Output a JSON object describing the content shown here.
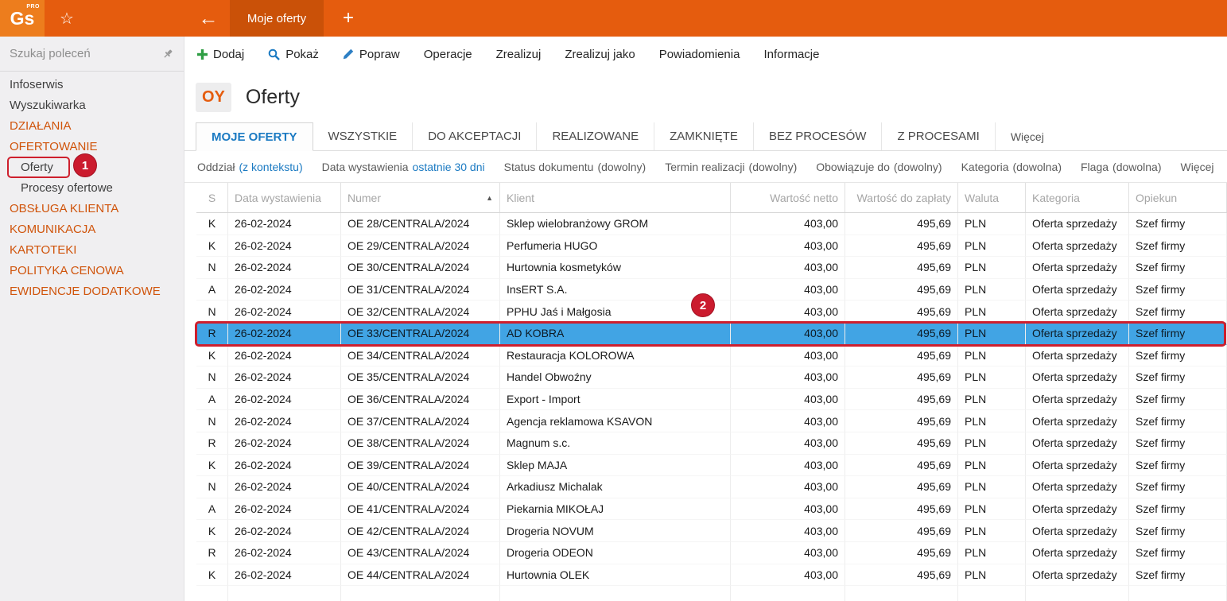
{
  "topbar": {
    "logo": "Gs",
    "logo_sup": "PRO",
    "star_icon": "☆",
    "back_arrow": "←",
    "document_tab": "Moje oferty",
    "new_tab_plus": "+"
  },
  "sidebar": {
    "search_placeholder": "Szukaj poleceń",
    "items": [
      {
        "label": "Infoserwis",
        "type": "item"
      },
      {
        "label": "Wyszukiwarka",
        "type": "item"
      },
      {
        "label": "DZIAŁANIA",
        "type": "category"
      },
      {
        "label": "OFERTOWANIE",
        "type": "category"
      },
      {
        "label": "Oferty",
        "type": "subitem",
        "annotated": true
      },
      {
        "label": "Procesy ofertowe",
        "type": "subitem"
      },
      {
        "label": "OBSŁUGA KLIENTA",
        "type": "category"
      },
      {
        "label": "KOMUNIKACJA",
        "type": "category"
      },
      {
        "label": "KARTOTEKI",
        "type": "category"
      },
      {
        "label": "POLITYKA CENOWA",
        "type": "category"
      },
      {
        "label": "EWIDENCJE DODATKOWE",
        "type": "category"
      }
    ]
  },
  "toolbar": [
    {
      "label": "Dodaj",
      "icon": "plus"
    },
    {
      "label": "Pokaż",
      "icon": "magnifier"
    },
    {
      "label": "Popraw",
      "icon": "pencil"
    },
    {
      "label": "Operacje",
      "icon": ""
    },
    {
      "label": "Zrealizuj",
      "icon": ""
    },
    {
      "label": "Zrealizuj jako",
      "icon": ""
    },
    {
      "label": "Powiadomienia",
      "icon": ""
    },
    {
      "label": "Informacje",
      "icon": ""
    }
  ],
  "page": {
    "badge": "OY",
    "title": "Oferty"
  },
  "tabs": [
    {
      "label": "MOJE OFERTY",
      "active": true,
      "more": false
    },
    {
      "label": "WSZYSTKIE",
      "active": false,
      "more": false
    },
    {
      "label": "DO AKCEPTACJI",
      "active": false,
      "more": false
    },
    {
      "label": "REALIZOWANE",
      "active": false,
      "more": false
    },
    {
      "label": "ZAMKNIĘTE",
      "active": false,
      "more": false
    },
    {
      "label": "BEZ PROCESÓW",
      "active": false,
      "more": false
    },
    {
      "label": "Z PROCESAMI",
      "active": false,
      "more": false
    },
    {
      "label": "Więcej",
      "active": false,
      "more": true
    }
  ],
  "filters": [
    {
      "label": "Oddział",
      "value": "(z kontekstu)",
      "link": true
    },
    {
      "label": "Data wystawienia",
      "value": "ostatnie 30 dni",
      "link": true
    },
    {
      "label": "Status dokumentu",
      "value": "(dowolny)",
      "link": false
    },
    {
      "label": "Termin realizacji",
      "value": "(dowolny)",
      "link": false
    },
    {
      "label": "Obowiązuje do",
      "value": "(dowolny)",
      "link": false
    },
    {
      "label": "Kategoria",
      "value": "(dowolna)",
      "link": false
    },
    {
      "label": "Flaga",
      "value": "(dowolna)",
      "link": false
    },
    {
      "label": "Więcej",
      "value": "",
      "link": false
    }
  ],
  "table": {
    "sort_indicator": "▲",
    "columns": [
      {
        "label": "S",
        "sorted": false
      },
      {
        "label": "Data wystawienia",
        "sorted": false
      },
      {
        "label": "Numer",
        "sorted": true
      },
      {
        "label": "Klient",
        "sorted": false
      },
      {
        "label": "Wartość netto",
        "sorted": false
      },
      {
        "label": "Wartość do zapłaty",
        "sorted": false
      },
      {
        "label": "Waluta",
        "sorted": false
      },
      {
        "label": "Kategoria",
        "sorted": false
      },
      {
        "label": "Opiekun",
        "sorted": false
      }
    ],
    "selected_row_index": 5,
    "rows": [
      {
        "s": "K",
        "date": "26-02-2024",
        "number": "OE 28/CENTRALA/2024",
        "client": "Sklep wielobranżowy GROM",
        "net": "403,00",
        "due": "495,69",
        "currency": "PLN",
        "category": "Oferta sprzedaży",
        "owner": "Szef firmy"
      },
      {
        "s": "K",
        "date": "26-02-2024",
        "number": "OE 29/CENTRALA/2024",
        "client": "Perfumeria HUGO",
        "net": "403,00",
        "due": "495,69",
        "currency": "PLN",
        "category": "Oferta sprzedaży",
        "owner": "Szef firmy"
      },
      {
        "s": "N",
        "date": "26-02-2024",
        "number": "OE 30/CENTRALA/2024",
        "client": "Hurtownia kosmetyków",
        "net": "403,00",
        "due": "495,69",
        "currency": "PLN",
        "category": "Oferta sprzedaży",
        "owner": "Szef firmy"
      },
      {
        "s": "A",
        "date": "26-02-2024",
        "number": "OE 31/CENTRALA/2024",
        "client": "InsERT S.A.",
        "net": "403,00",
        "due": "495,69",
        "currency": "PLN",
        "category": "Oferta sprzedaży",
        "owner": "Szef firmy"
      },
      {
        "s": "N",
        "date": "26-02-2024",
        "number": "OE 32/CENTRALA/2024",
        "client": "PPHU Jaś i Małgosia",
        "net": "403,00",
        "due": "495,69",
        "currency": "PLN",
        "category": "Oferta sprzedaży",
        "owner": "Szef firmy"
      },
      {
        "s": "R",
        "date": "26-02-2024",
        "number": "OE 33/CENTRALA/2024",
        "client": "AD KOBRA",
        "net": "403,00",
        "due": "495,69",
        "currency": "PLN",
        "category": "Oferta sprzedaży",
        "owner": "Szef firmy"
      },
      {
        "s": "K",
        "date": "26-02-2024",
        "number": "OE 34/CENTRALA/2024",
        "client": "Restauracja KOLOROWA",
        "net": "403,00",
        "due": "495,69",
        "currency": "PLN",
        "category": "Oferta sprzedaży",
        "owner": "Szef firmy"
      },
      {
        "s": "N",
        "date": "26-02-2024",
        "number": "OE 35/CENTRALA/2024",
        "client": "Handel Obwoźny",
        "net": "403,00",
        "due": "495,69",
        "currency": "PLN",
        "category": "Oferta sprzedaży",
        "owner": "Szef firmy"
      },
      {
        "s": "A",
        "date": "26-02-2024",
        "number": "OE 36/CENTRALA/2024",
        "client": "Export - Import",
        "net": "403,00",
        "due": "495,69",
        "currency": "PLN",
        "category": "Oferta sprzedaży",
        "owner": "Szef firmy"
      },
      {
        "s": "N",
        "date": "26-02-2024",
        "number": "OE 37/CENTRALA/2024",
        "client": "Agencja reklamowa KSAVON",
        "net": "403,00",
        "due": "495,69",
        "currency": "PLN",
        "category": "Oferta sprzedaży",
        "owner": "Szef firmy"
      },
      {
        "s": "R",
        "date": "26-02-2024",
        "number": "OE 38/CENTRALA/2024",
        "client": "Magnum s.c.",
        "net": "403,00",
        "due": "495,69",
        "currency": "PLN",
        "category": "Oferta sprzedaży",
        "owner": "Szef firmy"
      },
      {
        "s": "K",
        "date": "26-02-2024",
        "number": "OE 39/CENTRALA/2024",
        "client": "Sklep MAJA",
        "net": "403,00",
        "due": "495,69",
        "currency": "PLN",
        "category": "Oferta sprzedaży",
        "owner": "Szef firmy"
      },
      {
        "s": "N",
        "date": "26-02-2024",
        "number": "OE 40/CENTRALA/2024",
        "client": "Arkadiusz Michalak",
        "net": "403,00",
        "due": "495,69",
        "currency": "PLN",
        "category": "Oferta sprzedaży",
        "owner": "Szef firmy"
      },
      {
        "s": "A",
        "date": "26-02-2024",
        "number": "OE 41/CENTRALA/2024",
        "client": "Piekarnia MIKOŁAJ",
        "net": "403,00",
        "due": "495,69",
        "currency": "PLN",
        "category": "Oferta sprzedaży",
        "owner": "Szef firmy"
      },
      {
        "s": "K",
        "date": "26-02-2024",
        "number": "OE 42/CENTRALA/2024",
        "client": "Drogeria NOVUM",
        "net": "403,00",
        "due": "495,69",
        "currency": "PLN",
        "category": "Oferta sprzedaży",
        "owner": "Szef firmy"
      },
      {
        "s": "R",
        "date": "26-02-2024",
        "number": "OE 43/CENTRALA/2024",
        "client": "Drogeria ODEON",
        "net": "403,00",
        "due": "495,69",
        "currency": "PLN",
        "category": "Oferta sprzedaży",
        "owner": "Szef firmy"
      },
      {
        "s": "K",
        "date": "26-02-2024",
        "number": "OE 44/CENTRALA/2024",
        "client": "Hurtownia OLEK",
        "net": "403,00",
        "due": "495,69",
        "currency": "PLN",
        "category": "Oferta sprzedaży",
        "owner": "Szef firmy"
      }
    ]
  },
  "annotations": {
    "step1": "1",
    "step2": "2"
  },
  "colors": {
    "accent_orange": "#e55c0e",
    "link_blue": "#1b7ac2",
    "selection_blue": "#41a4e4",
    "annotation_red": "#ce1f2d"
  }
}
